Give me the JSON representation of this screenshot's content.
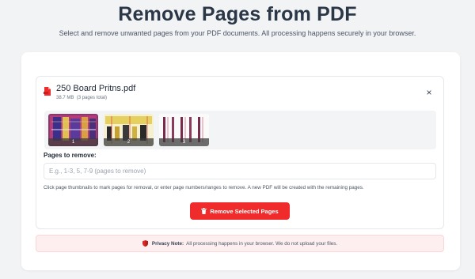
{
  "header": {
    "title": "Remove Pages from PDF",
    "subtitle": "Select and remove unwanted pages from your PDF documents. All processing happens securely in your browser."
  },
  "file": {
    "name": "250 Board Pritns.pdf",
    "size": "38.7 MB",
    "pages_total": "(3 pages total)",
    "close_symbol": "×",
    "icon": "pdf-file-icon"
  },
  "thumbnails": [
    {
      "page": "1"
    },
    {
      "page": "2"
    },
    {
      "page": "3"
    }
  ],
  "form": {
    "pages_label": "Pages to remove:",
    "pages_placeholder": "E.g., 1-3, 5, 7-9 (pages to remove)",
    "help": "Click page thumbnails to mark pages for removal, or enter page numbers/ranges to remove. A new PDF will be created with the remaining pages."
  },
  "action": {
    "remove_label": "Remove Selected Pages",
    "icon": "trash-icon"
  },
  "privacy": {
    "title": "Privacy Note:",
    "text": "All processing happens in your browser. We do not upload your files.",
    "icon": "shield-icon"
  },
  "colors": {
    "accent": "#ef2b2b",
    "privacy_bg": "#fdeff0",
    "title": "#2b3747"
  }
}
